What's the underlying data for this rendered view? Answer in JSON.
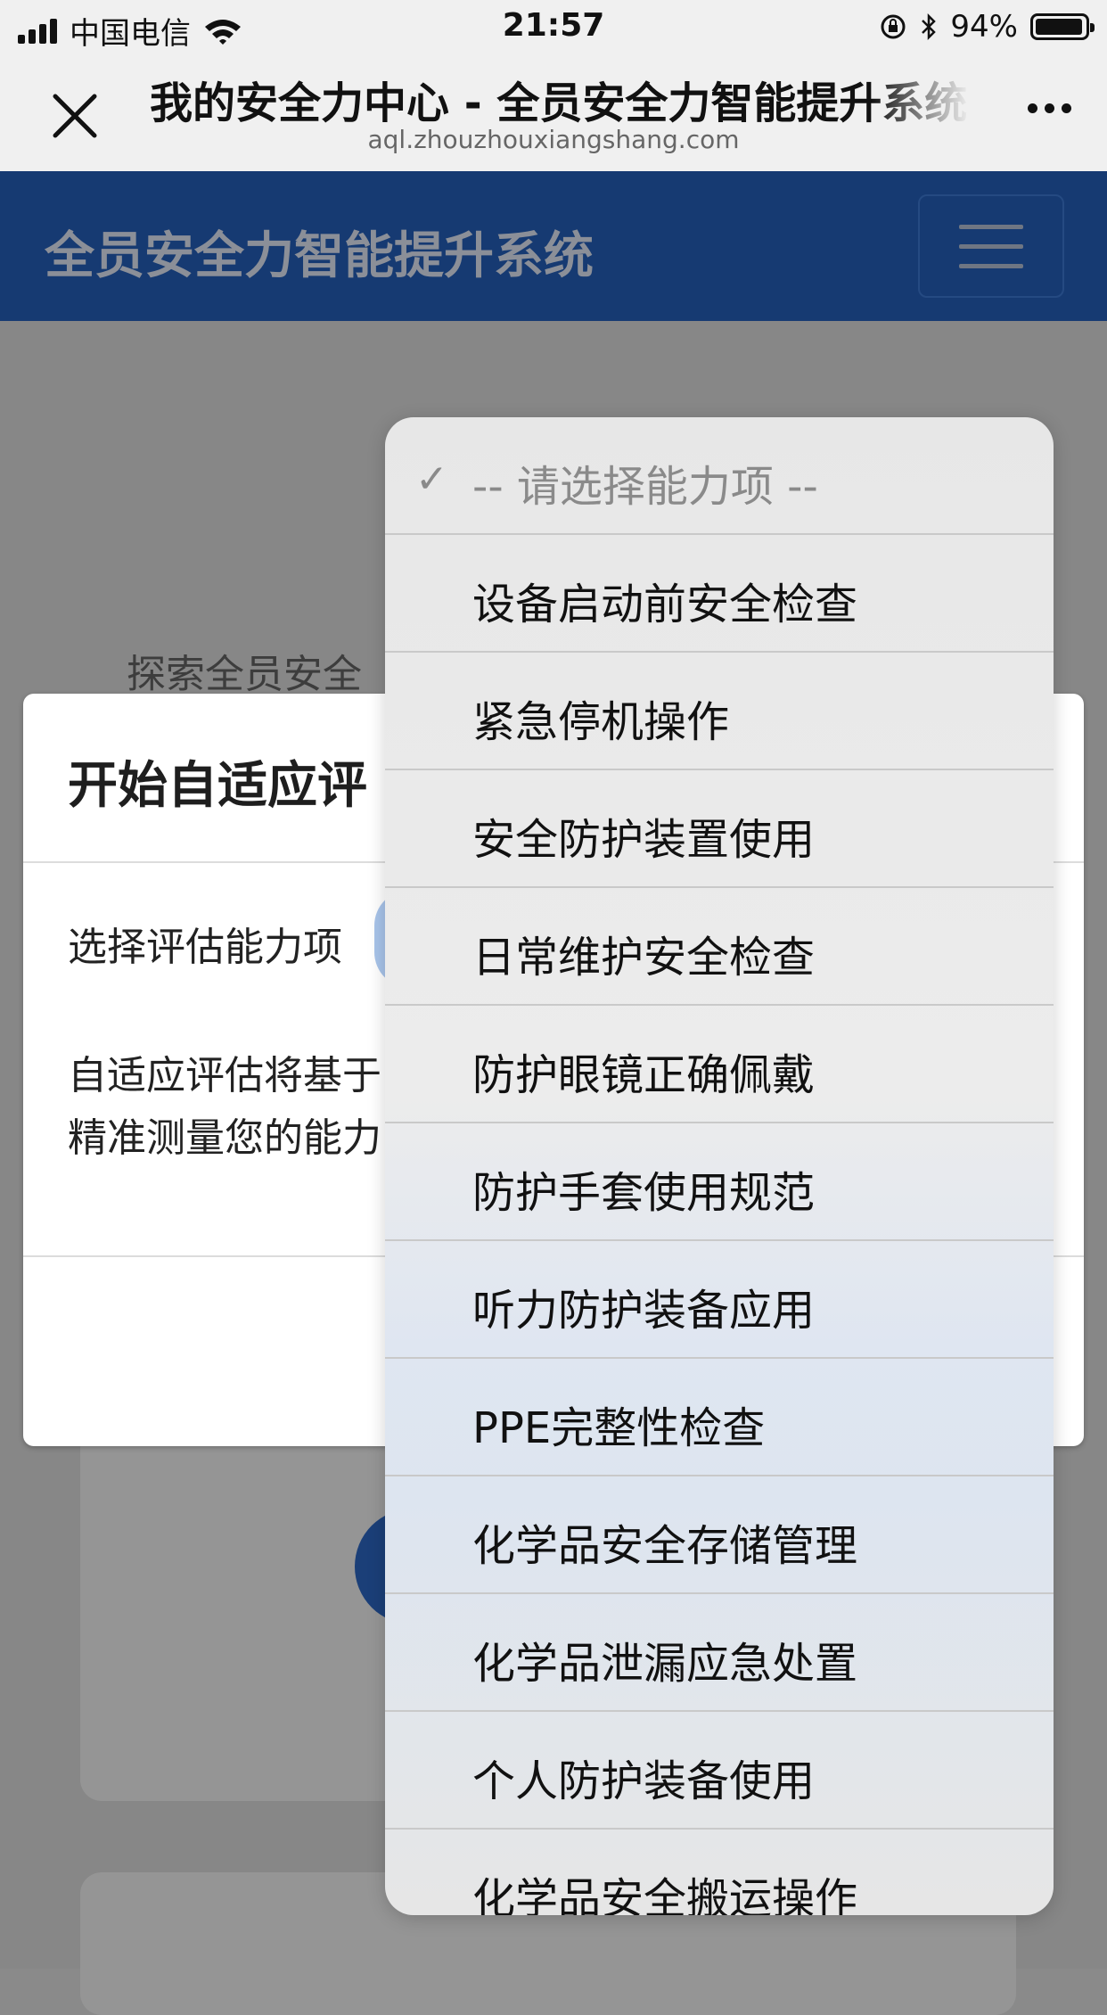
{
  "status_bar": {
    "carrier": "中国电信",
    "time": "21:57",
    "battery": "94%"
  },
  "browser": {
    "page_title": "我的安全力中心 - 全员安全力智能提升系统",
    "url": "aql.zhouzhouxiangshang.com"
  },
  "app": {
    "title": "全员安全力智能提升系统"
  },
  "background": {
    "text": "探索全员安全"
  },
  "modal": {
    "title": "开始自适应评",
    "select_label": "选择评估能力项",
    "description_line1": "自适应评估将基于",
    "description_line2": "精准测量您的能力"
  },
  "picker": {
    "placeholder": "-- 请选择能力项 --",
    "options": [
      "设备启动前安全检查",
      "紧急停机操作",
      "安全防护装置使用",
      "日常维护安全检查",
      "防护眼镜正确佩戴",
      "防护手套使用规范",
      "听力防护装备应用",
      "PPE完整性检查",
      "化学品安全存储管理",
      "化学品泄漏应急处置",
      "个人防护装备使用",
      "化学品安全搬运操作"
    ]
  },
  "icons": {
    "close": "close-icon",
    "more": "more-icon",
    "menu": "hamburger-icon",
    "check": "checkmark-icon"
  }
}
